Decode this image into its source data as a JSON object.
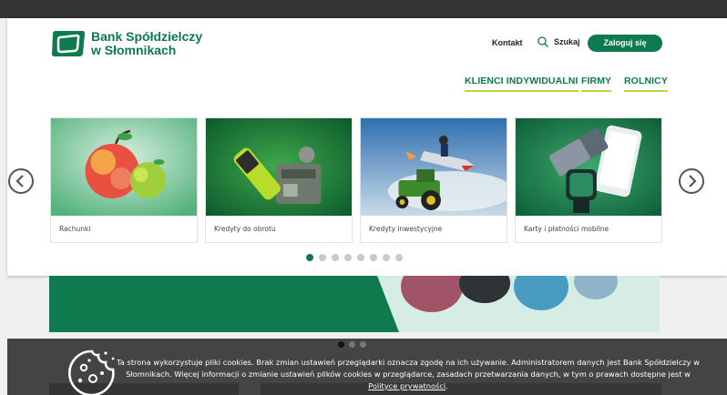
{
  "header": {
    "logo_line1": "Bank Spółdzielczy",
    "logo_line2": "w Słomnikach",
    "kontakt": "Kontakt",
    "search_label": "Szukaj",
    "login_label": "Zaloguj się"
  },
  "nav": {
    "items": [
      {
        "label": "KLIENCI INDYWIDUALNI"
      },
      {
        "label": "FIRMY"
      },
      {
        "label": "ROLNICY"
      }
    ]
  },
  "carousel": {
    "cards": [
      {
        "caption": "Rachunki",
        "icon": "apple-puzzle-image"
      },
      {
        "caption": "Kredyty do obrotu",
        "icon": "battery-charger-image"
      },
      {
        "caption": "Kredyty inwestycyjne",
        "icon": "tractor-rocket-image"
      },
      {
        "caption": "Karty i płatności mobilne",
        "icon": "phone-smartwatch-image"
      }
    ],
    "dot_count": 8,
    "active_dot": 1,
    "prev_icon": "chevron-left-icon",
    "next_icon": "chevron-right-icon"
  },
  "cookie": {
    "text_before_link": "Ta strona wykorzystuje pliki cookies. Brak zmian ustawień przeglądarki oznacza zgodę na ich używanie. Administratorem danych jest Bank Spółdzielczy w Słomnikach. Więcej informacji o zmianie ustawień plików cookies w przeglądarce, zasadach przetwarzania danych, w tym o prawach dostępne jest w ",
    "link_text": "Polityce prywatności",
    "text_after_link": ".",
    "icon": "cookie-icon"
  },
  "colors": {
    "brand_green": "#0e7a4d",
    "nav_underline": "#b7d93f"
  }
}
